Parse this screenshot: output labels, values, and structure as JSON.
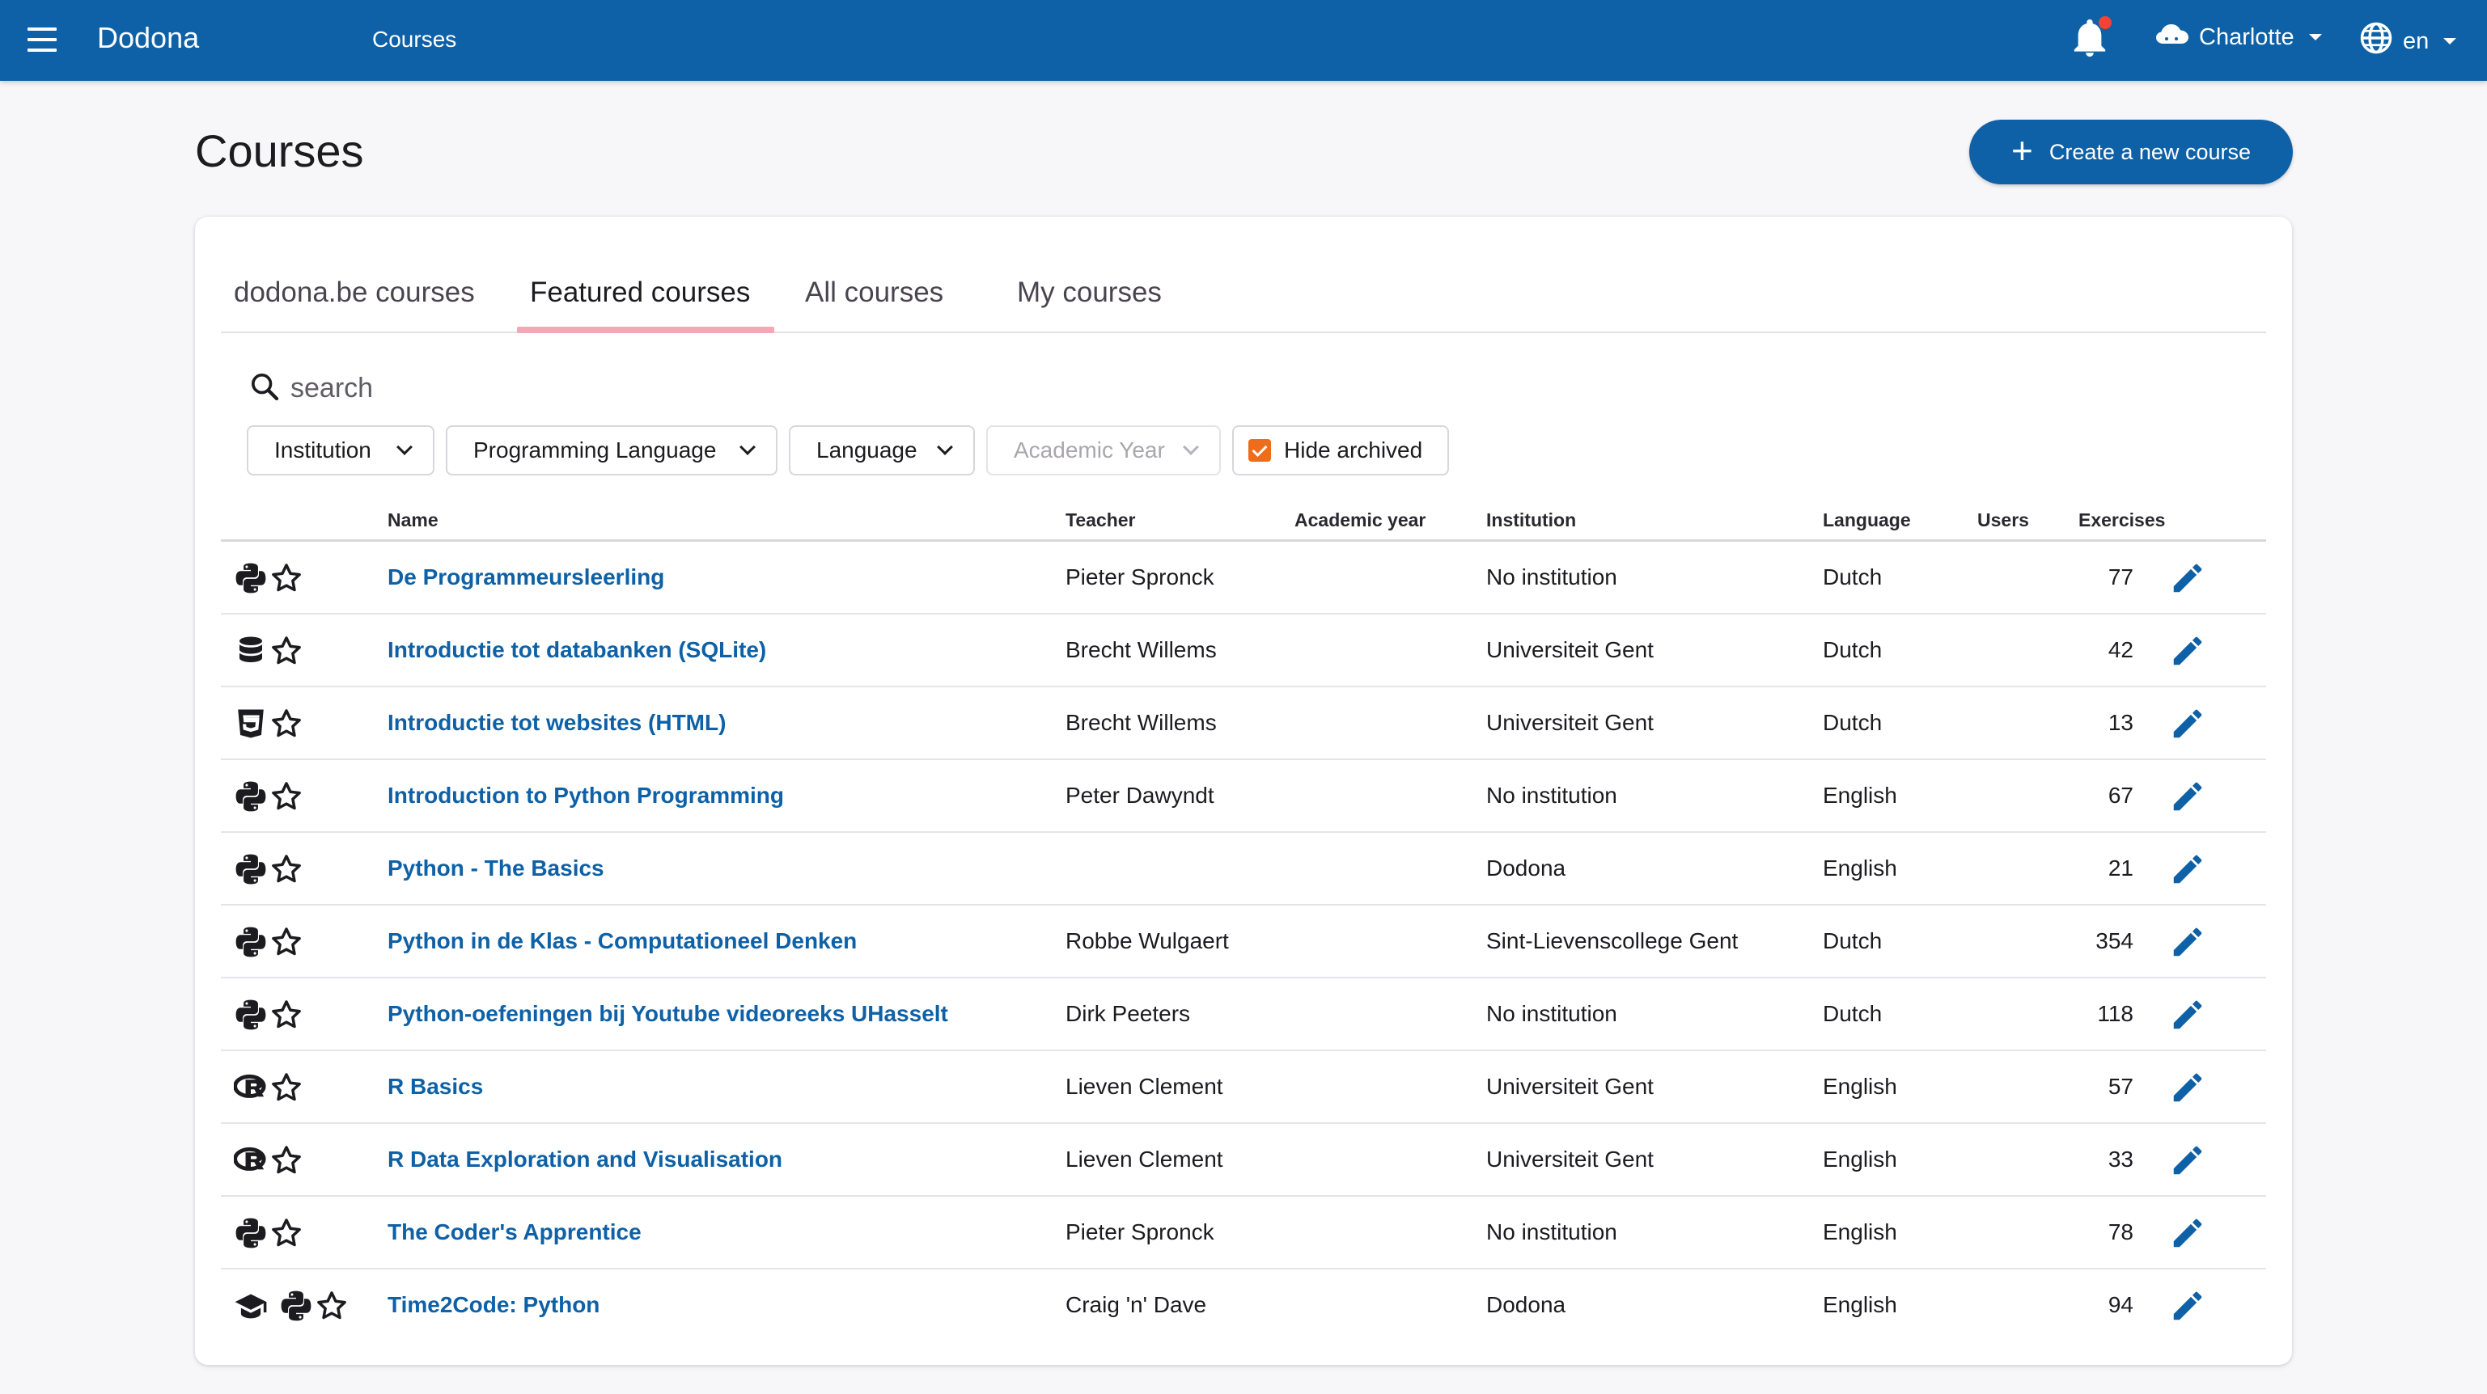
{
  "topbar": {
    "brand": "Dodona",
    "breadcrumb": "Courses",
    "user_name": "Charlotte",
    "language": "en"
  },
  "page": {
    "title": "Courses",
    "create_label": "Create a new course"
  },
  "tabs": [
    {
      "label": "dodona.be courses",
      "active": false
    },
    {
      "label": "Featured courses",
      "active": true
    },
    {
      "label": "All courses",
      "active": false
    },
    {
      "label": "My courses",
      "active": false
    }
  ],
  "search": {
    "placeholder": "search"
  },
  "filters": {
    "institution": "Institution",
    "programming_language": "Programming Language",
    "language": "Language",
    "academic_year": "Academic Year",
    "hide_archived": "Hide archived",
    "hide_archived_checked": true
  },
  "table": {
    "headers": {
      "name": "Name",
      "teacher": "Teacher",
      "academic_year": "Academic year",
      "institution": "Institution",
      "language": "Language",
      "users": "Users",
      "exercises": "Exercises"
    },
    "rows": [
      {
        "icons": [
          "python-icon"
        ],
        "name": "De Programmeursleerling",
        "teacher": "Pieter Spronck",
        "year": "",
        "institution": "No institution",
        "language": "Dutch",
        "users": "",
        "exercises": "77"
      },
      {
        "icons": [
          "database-icon"
        ],
        "name": "Introductie tot databanken (SQLite)",
        "teacher": "Brecht Willems",
        "year": "",
        "institution": "Universiteit Gent",
        "language": "Dutch",
        "users": "",
        "exercises": "42"
      },
      {
        "icons": [
          "html5-icon"
        ],
        "name": "Introductie tot websites (HTML)",
        "teacher": "Brecht Willems",
        "year": "",
        "institution": "Universiteit Gent",
        "language": "Dutch",
        "users": "",
        "exercises": "13"
      },
      {
        "icons": [
          "python-icon"
        ],
        "name": "Introduction to Python Programming",
        "teacher": "Peter Dawyndt",
        "year": "",
        "institution": "No institution",
        "language": "English",
        "users": "",
        "exercises": "67"
      },
      {
        "icons": [
          "python-icon"
        ],
        "name": "Python - The Basics",
        "teacher": "",
        "year": "",
        "institution": "Dodona",
        "language": "English",
        "users": "",
        "exercises": "21"
      },
      {
        "icons": [
          "python-icon"
        ],
        "name": "Python in de Klas - Computationeel Denken",
        "teacher": "Robbe Wulgaert",
        "year": "",
        "institution": "Sint-Lievenscollege Gent",
        "language": "Dutch",
        "users": "",
        "exercises": "354"
      },
      {
        "icons": [
          "python-icon"
        ],
        "name": "Python-oefeningen bij Youtube videoreeks UHasselt",
        "teacher": "Dirk Peeters",
        "year": "",
        "institution": "No institution",
        "language": "Dutch",
        "users": "",
        "exercises": "118"
      },
      {
        "icons": [
          "r-language-icon"
        ],
        "name": "R Basics",
        "teacher": "Lieven Clement",
        "year": "",
        "institution": "Universiteit Gent",
        "language": "English",
        "users": "",
        "exercises": "57"
      },
      {
        "icons": [
          "r-language-icon"
        ],
        "name": "R Data Exploration and Visualisation",
        "teacher": "Lieven Clement",
        "year": "",
        "institution": "Universiteit Gent",
        "language": "English",
        "users": "",
        "exercises": "33"
      },
      {
        "icons": [
          "python-icon"
        ],
        "name": "The Coder's Apprentice",
        "teacher": "Pieter Spronck",
        "year": "",
        "institution": "No institution",
        "language": "English",
        "users": "",
        "exercises": "78"
      },
      {
        "icons": [
          "graduation-cap-icon",
          "python-icon"
        ],
        "name": "Time2Code: Python",
        "teacher": "Craig 'n' Dave",
        "year": "",
        "institution": "Dodona",
        "language": "English",
        "users": "",
        "exercises": "94"
      }
    ]
  },
  "colors": {
    "primary": "#0e61a6",
    "tab_indicator": "#f3a8b6",
    "checkbox": "#ef6c1a",
    "notification_dot": "#f44336"
  }
}
